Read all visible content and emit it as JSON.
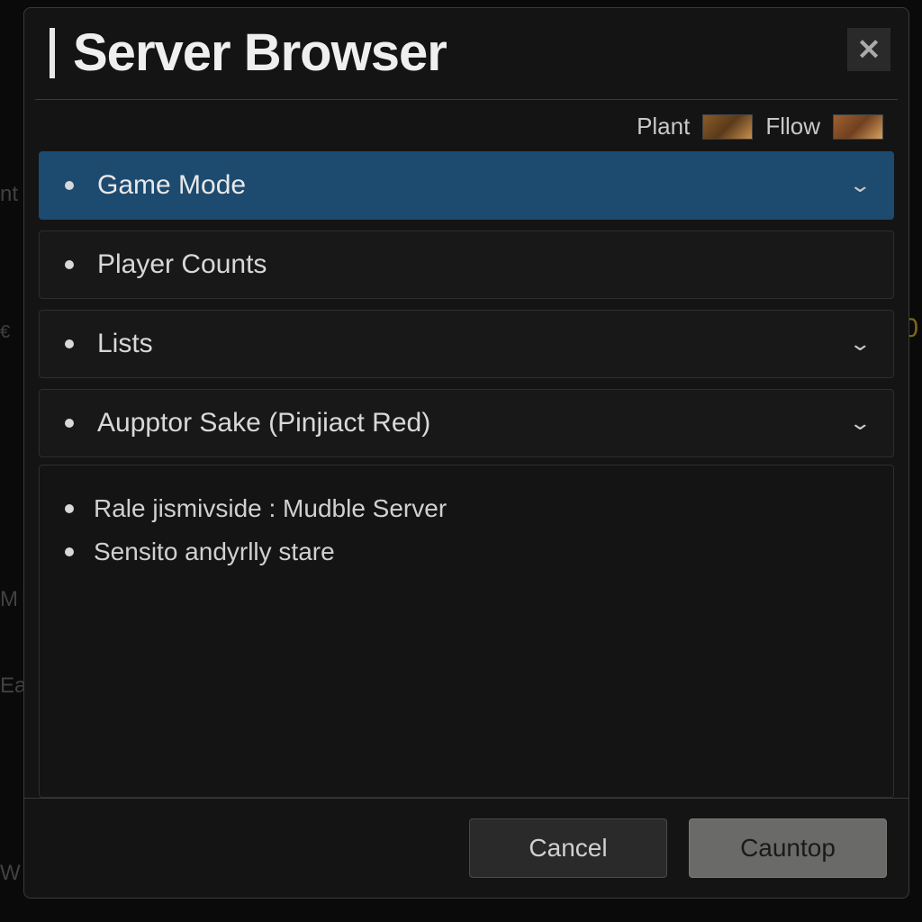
{
  "dialog": {
    "title": "Server Browser"
  },
  "topRow": {
    "plant_label": "Plant",
    "fllow_label": "Fllow"
  },
  "filters": [
    {
      "label": "Game Mode",
      "active": true,
      "chevron": true
    },
    {
      "label": "Player Counts",
      "active": false,
      "chevron": false
    },
    {
      "label": "Lists",
      "active": false,
      "chevron": true
    },
    {
      "label": "Aupptor Sake (Pinjiact Red)",
      "active": false,
      "chevron": true
    }
  ],
  "subItems": [
    {
      "label": "Rale jismivside : Mudble Server"
    },
    {
      "label": "Sensito andyrlly stare"
    }
  ],
  "footer": {
    "cancel": "Cancel",
    "primary": "Cauntop"
  },
  "bgHints": {
    "nt": "nt",
    "euro": "€",
    "zero": "0",
    "m": "M",
    "ea": "Ea",
    "w": "W"
  }
}
